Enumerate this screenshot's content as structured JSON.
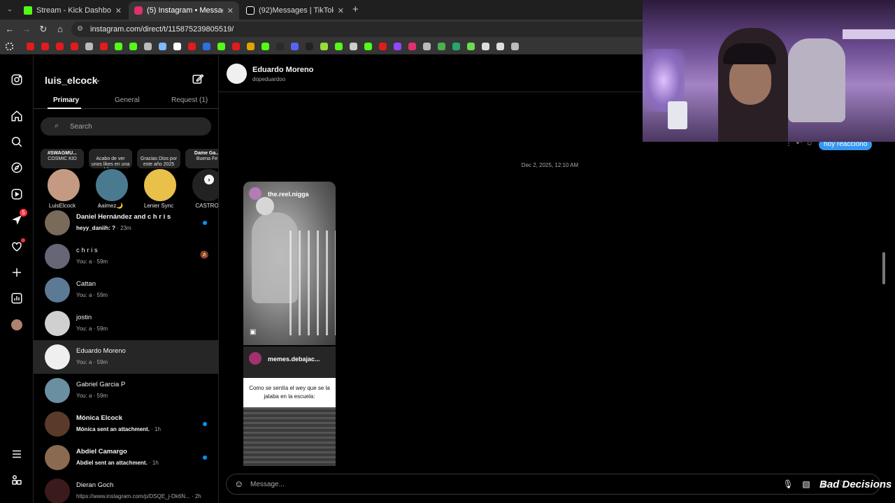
{
  "browser": {
    "tabs": [
      {
        "title": "Stream - Kick Dashboard",
        "color": "#53fc18"
      },
      {
        "title": "(5) Instagram • Messages",
        "color": "#e1306c"
      },
      {
        "title": "(92)Messages | TikTok",
        "color": "#ffffff"
      }
    ],
    "url": "instagram.com/direct/t/115875239805519/",
    "bookmark_colors": [
      "#e31b1b",
      "#e31b1b",
      "#e31b1b",
      "#e31b1b",
      "#bbbbbb",
      "#e31b1b",
      "#53fc18",
      "#53fc18",
      "#bbbbbb",
      "#7fb8ff",
      "#ffffff",
      "#e31b1b",
      "#2f6fdf",
      "#53fc18",
      "#e31b1b",
      "#e0a300",
      "#53fc18",
      "#2a2a2a",
      "#5865f2",
      "#222222",
      "#9adc3c",
      "#53fc18",
      "#cccccc",
      "#53fc18",
      "#e31b1b",
      "#9146ff",
      "#e1306c",
      "#bbbbbb",
      "#4caf50",
      "#25a76a",
      "#6adc50",
      "#dddddd",
      "#dddddd",
      "#bbbbbb"
    ]
  },
  "inbox": {
    "username": "luis_elcock",
    "folders": [
      "Primary",
      "General",
      "Request (1)"
    ],
    "search_placeholder": "Search",
    "notifications_badge": "5",
    "notes": [
      {
        "bubble_title": "#SWAGMU...",
        "bubble_sub": "COSMIC KID",
        "name": "LuisElcock",
        "color": "#c49a82"
      },
      {
        "bubble_title": "",
        "bubble_sub": "Acabo de ver unos likes en una publi que...",
        "name": "Ѧаimez🌙",
        "color": "#4a7a8f"
      },
      {
        "bubble_title": "",
        "bubble_sub": "Gracias Dios por este año 2025",
        "name": "Lenier Sync",
        "color": "#e8c04a"
      },
      {
        "bubble_title": "Dame Ga...",
        "bubble_sub": "Buena Fe",
        "name": "CASTRO",
        "color": "#222222"
      }
    ],
    "threads": [
      {
        "name": "Daniel Hernández and c h r i s",
        "sender": "heyy_daniih: ?",
        "time": " · 23m",
        "unread": true,
        "muted": false,
        "avatar": "#7a6a5a"
      },
      {
        "name": "c h r i s",
        "sender": "You: a",
        "time": " · 59m",
        "unread": false,
        "muted": true,
        "avatar": "#666677"
      },
      {
        "name": "Cattan",
        "sender": "You: a",
        "time": " · 59m",
        "unread": false,
        "muted": false,
        "avatar": "#5c7a96"
      },
      {
        "name": "jostin",
        "sender": "You: a",
        "time": " · 59m",
        "unread": false,
        "muted": false,
        "avatar": "#d0d0d0"
      },
      {
        "name": "Eduardo Moreno",
        "sender": "You: a",
        "time": " · 59m",
        "unread": false,
        "muted": false,
        "avatar": "#efefef"
      },
      {
        "name": "Gabriel Garcia P",
        "sender": "You: a",
        "time": " · 59m",
        "unread": false,
        "muted": false,
        "avatar": "#6a8fa0"
      },
      {
        "name": "Mónica Elcock",
        "sender": "Mónica sent an attachment.",
        "time": " · 1h",
        "unread": true,
        "muted": false,
        "avatar": "#5a3a2a"
      },
      {
        "name": "Abdiel Camargo",
        "sender": "Abdiel sent an attachment.",
        "time": " · 1h",
        "unread": true,
        "muted": false,
        "avatar": "#8a6a50"
      },
      {
        "name": "Dieran Goch",
        "sender": "https://www.instagram.com/p/DSQE_j-Dk6N...",
        "time": " · 2h",
        "unread": false,
        "muted": false,
        "avatar": "#3a1a1a"
      }
    ]
  },
  "chat": {
    "contact_name": "Eduardo Moreno",
    "contact_handle": "dopeduardoo",
    "last_message": "hoy reacciono",
    "timestamp": "Dec 2, 2025, 12:10 AM",
    "shares": [
      {
        "account": "the.reel.nigga"
      },
      {
        "account": "memes.debajac...",
        "caption": "Como se sentía el wey que se la jalaba en la escuela:"
      }
    ],
    "composer_placeholder": "Message..."
  },
  "overlay": {
    "watermark": "Bad Decisions"
  }
}
